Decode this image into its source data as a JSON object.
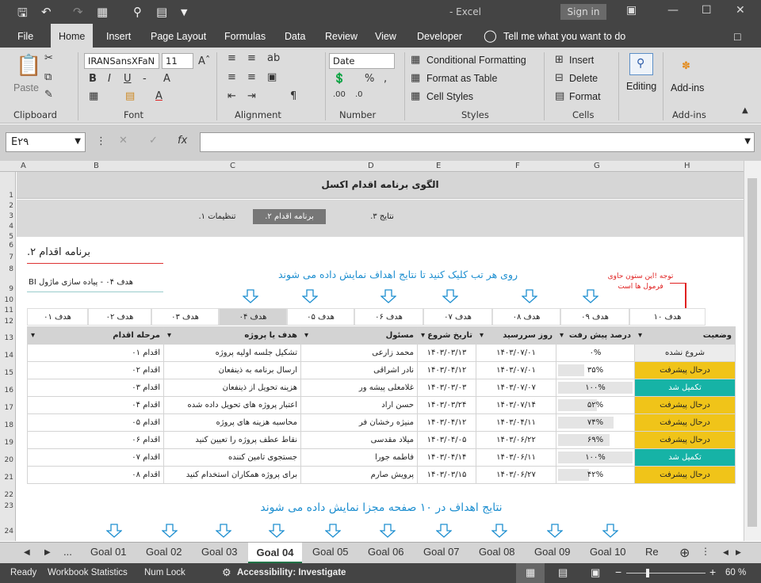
{
  "titlebar": {
    "title": "- Excel",
    "signin": "Sign in"
  },
  "menu": {
    "tabs": [
      "File",
      "Home",
      "Insert",
      "Page Layout",
      "Formulas",
      "Data",
      "Review",
      "View",
      "Developer"
    ],
    "tell": "Tell me what you want to do"
  },
  "ribbon": {
    "paste": "Paste",
    "clipboard": "Clipboard",
    "font_name": "IRANSansXFaN",
    "font_size": "11",
    "font": "Font",
    "alignment": "Alignment",
    "number_format": "Date",
    "number": "Number",
    "cond": "Conditional Formatting",
    "fmt_table": "Format as Table",
    "cell_styles": "Cell Styles",
    "styles": "Styles",
    "insert": "Insert",
    "delete": "Delete",
    "format": "Format",
    "cells": "Cells",
    "editing": "Editing",
    "addins": "Add-ins",
    "addins_grp": "Add-ins"
  },
  "formula": {
    "namebox": "E۲۹",
    "fx": "fx"
  },
  "columns": [
    "A",
    "B",
    "C",
    "D",
    "E",
    "F",
    "G",
    "H"
  ],
  "rows": [
    "1",
    "2",
    "3",
    "4",
    "5",
    "6",
    "7",
    "8",
    "9",
    "10",
    "11",
    "12",
    "13",
    "14",
    "15",
    "16",
    "17",
    "18",
    "19",
    "20",
    "21",
    "22",
    "23",
    "24"
  ],
  "sheet": {
    "title": "الگوی برنامه اقدام اکسل",
    "nav": [
      "نتایج ۳.",
      "برنامه اقدام ۲.",
      "تنظیمات ۱."
    ],
    "section": "برنامه اقدام ۲.",
    "goal_select": "هدف ۰۴ - پیاده سازی ماژول BI",
    "hint": "روی هر تب کلیک کنید تا نتایج اهداف نمایش داده می شوند",
    "note": "توجه !این ستون حاوی فرمول ها است",
    "goal_tabs": [
      "هدف ۱۰",
      "هدف ۰۹",
      "هدف ۰۸",
      "هدف ۰۷",
      "هدف ۰۶",
      "هدف ۰۵",
      "هدف ۰۴",
      "هدف ۰۳",
      "هدف ۰۲",
      "هدف ۰۱"
    ],
    "headers": [
      "وضعیت",
      "درصد پیش رفت",
      "روز سررسید",
      "تاریخ شروع",
      "مسئول",
      "هدف یا پروژه",
      "مرحله اقدام"
    ],
    "rows": [
      {
        "status": "شروع نشده",
        "progress": "۰%",
        "due": "۱۴۰۳/۰۷/۰۱",
        "start": "۱۴۰۳/۰۳/۱۳",
        "owner": "محمد زارعی",
        "task": "تشکیل جلسه اولیه پروژه",
        "step": "اقدام ۰۱",
        "fill": 0
      },
      {
        "status": "درحال پیشرفت",
        "progress": "۳۵%",
        "due": "۱۴۰۳/۰۷/۰۱",
        "start": "۱۴۰۳/۰۴/۱۲",
        "owner": "نادر اشراقی",
        "task": "ارسال برنامه به ذینفعان",
        "step": "اقدام ۰۲",
        "fill": 0.35
      },
      {
        "status": "تکمیل شد",
        "progress": "۱۰۰%",
        "due": "۱۴۰۳/۰۷/۰۷",
        "start": "۱۴۰۳/۰۳/۰۳",
        "owner": "غلامعلی  پیشه ور",
        "task": "هزینه تحویل از ذینفعان",
        "step": "اقدام ۰۳",
        "fill": 1
      },
      {
        "status": "درحال پیشرفت",
        "progress": "۵۲%",
        "due": "۱۴۰۳/۰۷/۱۴",
        "start": "۱۴۰۳/۰۳/۲۴",
        "owner": "حسن اراد",
        "task": "اعتبار پروژه های تحویل داده شده",
        "step": "اقدام ۰۴",
        "fill": 0.52
      },
      {
        "status": "درحال پیشرفت",
        "progress": "۷۴%",
        "due": "۱۴۰۳/۰۴/۱۱",
        "start": "۱۴۰۳/۰۴/۱۲",
        "owner": "منیژه رخشان فر",
        "task": "محاسبه هزینه های پروژه",
        "step": "اقدام ۰۵",
        "fill": 0.74
      },
      {
        "status": "درحال پیشرفت",
        "progress": "۶۹%",
        "due": "۱۴۰۳/۰۶/۲۲",
        "start": "۱۴۰۳/۰۴/۰۵",
        "owner": "میلاد مقدسی",
        "task": "نقاط عطف پروژه را تعیین کنید",
        "step": "اقدام ۰۶",
        "fill": 0.69
      },
      {
        "status": "تکمیل شد",
        "progress": "۱۰۰%",
        "due": "۱۴۰۳/۰۶/۱۱",
        "start": "۱۴۰۳/۰۴/۱۴",
        "owner": "فاطمه جورا",
        "task": "جستجوی تامین کننده",
        "step": "اقدام ۰۷",
        "fill": 1
      },
      {
        "status": "درحال پیشرفت",
        "progress": "۴۲%",
        "due": "۱۴۰۳/۰۶/۲۷",
        "start": "۱۴۰۳/۰۳/۱۵",
        "owner": "پرویش صارم",
        "task": "برای پروژه همکاران استخدام کنید",
        "step": "اقدام ۰۸",
        "fill": 0.42
      }
    ],
    "footer_hint": "نتایج اهداف در ۱۰ صفحه مجزا نمایش داده می شوند"
  },
  "sheet_tabs": {
    "more": "...",
    "tabs": [
      "Goal 01",
      "Goal 02",
      "Goal 03",
      "Goal 04",
      "Goal 05",
      "Goal 06",
      "Goal 07",
      "Goal 08",
      "Goal 09",
      "Goal 10",
      "Re"
    ]
  },
  "status": {
    "ready": "Ready",
    "stats": "Workbook Statistics",
    "numlock": "Num Lock",
    "access": "Accessibility: Investigate",
    "zoom": "60 %"
  },
  "colors": {
    "progress": "#f0c419",
    "done": "#16b3a6",
    "header": "#d3d3d3",
    "accent": "#1e8fd0",
    "note": "#e02020"
  }
}
